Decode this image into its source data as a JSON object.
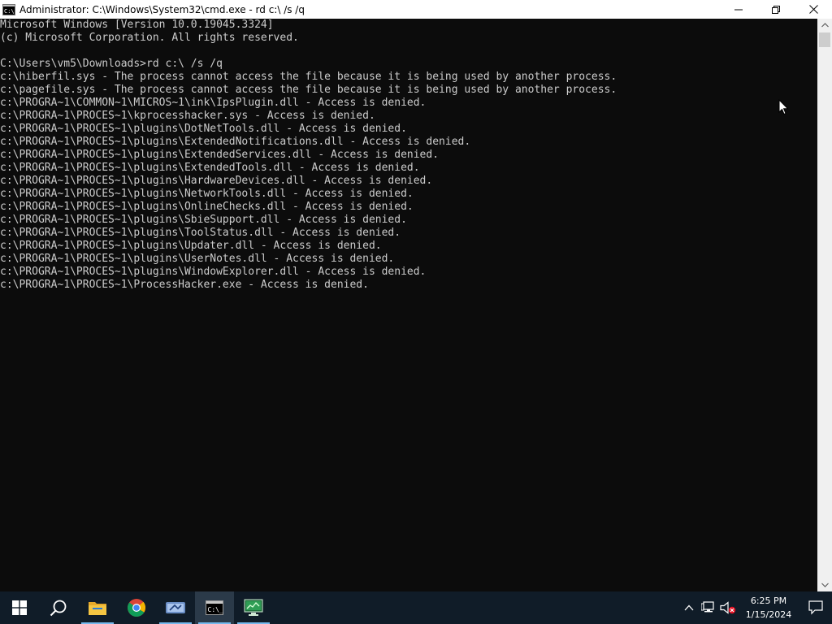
{
  "window": {
    "title": "Administrator: C:\\Windows\\System32\\cmd.exe - rd  c:\\ /s /q",
    "icon": "cmd-icon"
  },
  "caption_buttons": {
    "minimize": "minimize-icon",
    "restore": "restore-icon",
    "close": "close-icon"
  },
  "console": {
    "lines": [
      "Microsoft Windows [Version 10.0.19045.3324]",
      "(c) Microsoft Corporation. All rights reserved.",
      "",
      "C:\\Users\\vm5\\Downloads>rd c:\\ /s /q",
      "c:\\hiberfil.sys - The process cannot access the file because it is being used by another process.",
      "c:\\pagefile.sys - The process cannot access the file because it is being used by another process.",
      "c:\\PROGRA~1\\COMMON~1\\MICROS~1\\ink\\IpsPlugin.dll - Access is denied.",
      "c:\\PROGRA~1\\PROCES~1\\kprocesshacker.sys - Access is denied.",
      "c:\\PROGRA~1\\PROCES~1\\plugins\\DotNetTools.dll - Access is denied.",
      "c:\\PROGRA~1\\PROCES~1\\plugins\\ExtendedNotifications.dll - Access is denied.",
      "c:\\PROGRA~1\\PROCES~1\\plugins\\ExtendedServices.dll - Access is denied.",
      "c:\\PROGRA~1\\PROCES~1\\plugins\\ExtendedTools.dll - Access is denied.",
      "c:\\PROGRA~1\\PROCES~1\\plugins\\HardwareDevices.dll - Access is denied.",
      "c:\\PROGRA~1\\PROCES~1\\plugins\\NetworkTools.dll - Access is denied.",
      "c:\\PROGRA~1\\PROCES~1\\plugins\\OnlineChecks.dll - Access is denied.",
      "c:\\PROGRA~1\\PROCES~1\\plugins\\SbieSupport.dll - Access is denied.",
      "c:\\PROGRA~1\\PROCES~1\\plugins\\ToolStatus.dll - Access is denied.",
      "c:\\PROGRA~1\\PROCES~1\\plugins\\Updater.dll - Access is denied.",
      "c:\\PROGRA~1\\PROCES~1\\plugins\\UserNotes.dll - Access is denied.",
      "c:\\PROGRA~1\\PROCES~1\\plugins\\WindowExplorer.dll - Access is denied.",
      "c:\\PROGRA~1\\PROCES~1\\ProcessHacker.exe - Access is denied."
    ]
  },
  "taskbar": {
    "items": [
      {
        "name": "start-button",
        "icon": "windows-logo-icon"
      },
      {
        "name": "search-button",
        "icon": "search-icon"
      },
      {
        "name": "file-explorer-button",
        "icon": "folder-icon"
      },
      {
        "name": "chrome-button",
        "icon": "chrome-icon"
      },
      {
        "name": "app-button",
        "icon": "app-icon"
      },
      {
        "name": "cmd-taskbar-button",
        "icon": "cmd-icon",
        "active": true
      },
      {
        "name": "manager-button",
        "icon": "monitor-icon"
      }
    ],
    "clock_time": "6:25 PM",
    "clock_date": "1/15/2024",
    "tray_icons": [
      "chevron-up-icon",
      "network-icon",
      "volume-muted-icon"
    ],
    "notification_icon": "notification-icon"
  },
  "colors": {
    "console_bg": "#0c0c0c",
    "console_text": "#cccccc",
    "taskbar_bg": "#101c28",
    "accent": "#76b9ed"
  }
}
